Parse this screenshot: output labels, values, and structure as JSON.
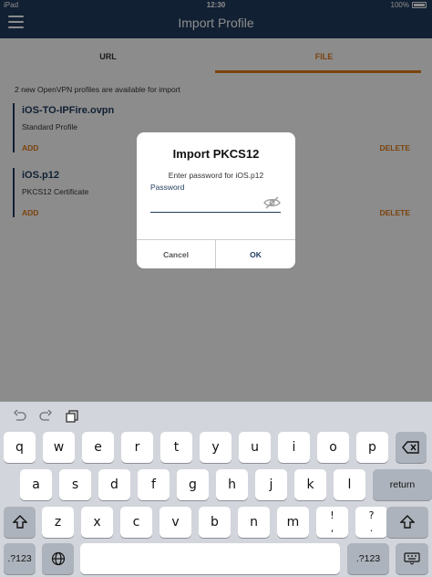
{
  "status_bar": {
    "carrier": "iPad",
    "time": "12:30",
    "battery": "100%"
  },
  "nav": {
    "title": "Import Profile"
  },
  "tabs": [
    {
      "label": "URL"
    },
    {
      "label": "FILE"
    }
  ],
  "info_text": "2 new OpenVPN profiles are available for import",
  "profiles": [
    {
      "name": "iOS-TO-IPFire.ovpn",
      "description": "Standard Profile",
      "add_label": "ADD",
      "delete_label": "DELETE"
    },
    {
      "name": "iOS.p12",
      "description": "PKCS12 Certificate",
      "add_label": "ADD",
      "delete_label": "DELETE"
    }
  ],
  "dialog": {
    "title": "Import PKCS12",
    "message": "Enter password for iOS.p12",
    "password_label": "Password",
    "password_value": "",
    "cancel_label": "Cancel",
    "ok_label": "OK"
  },
  "keyboard": {
    "row1": [
      "q",
      "w",
      "e",
      "r",
      "t",
      "y",
      "u",
      "i",
      "o",
      "p"
    ],
    "row2": [
      "a",
      "s",
      "d",
      "f",
      "g",
      "h",
      "j",
      "k",
      "l"
    ],
    "row3": [
      "z",
      "x",
      "c",
      "v",
      "b",
      "n",
      "m"
    ],
    "row3_punct1": {
      "top": "!",
      "bottom": ","
    },
    "row3_punct2": {
      "top": "?",
      "bottom": "."
    },
    "return_label": "return",
    "numbers_label": ".?123"
  },
  "colors": {
    "nav_bg": "#1f3b5e",
    "accent": "#e07a1b"
  },
  "icons": {
    "menu": "hamburger-icon",
    "eye": "eye-off-icon",
    "undo": "undo-icon",
    "redo": "redo-icon",
    "paste": "paste-icon",
    "globe": "globe-icon",
    "backspace": "backspace-icon",
    "shift": "shift-icon",
    "hide_keyboard": "keyboard-hide-icon"
  }
}
